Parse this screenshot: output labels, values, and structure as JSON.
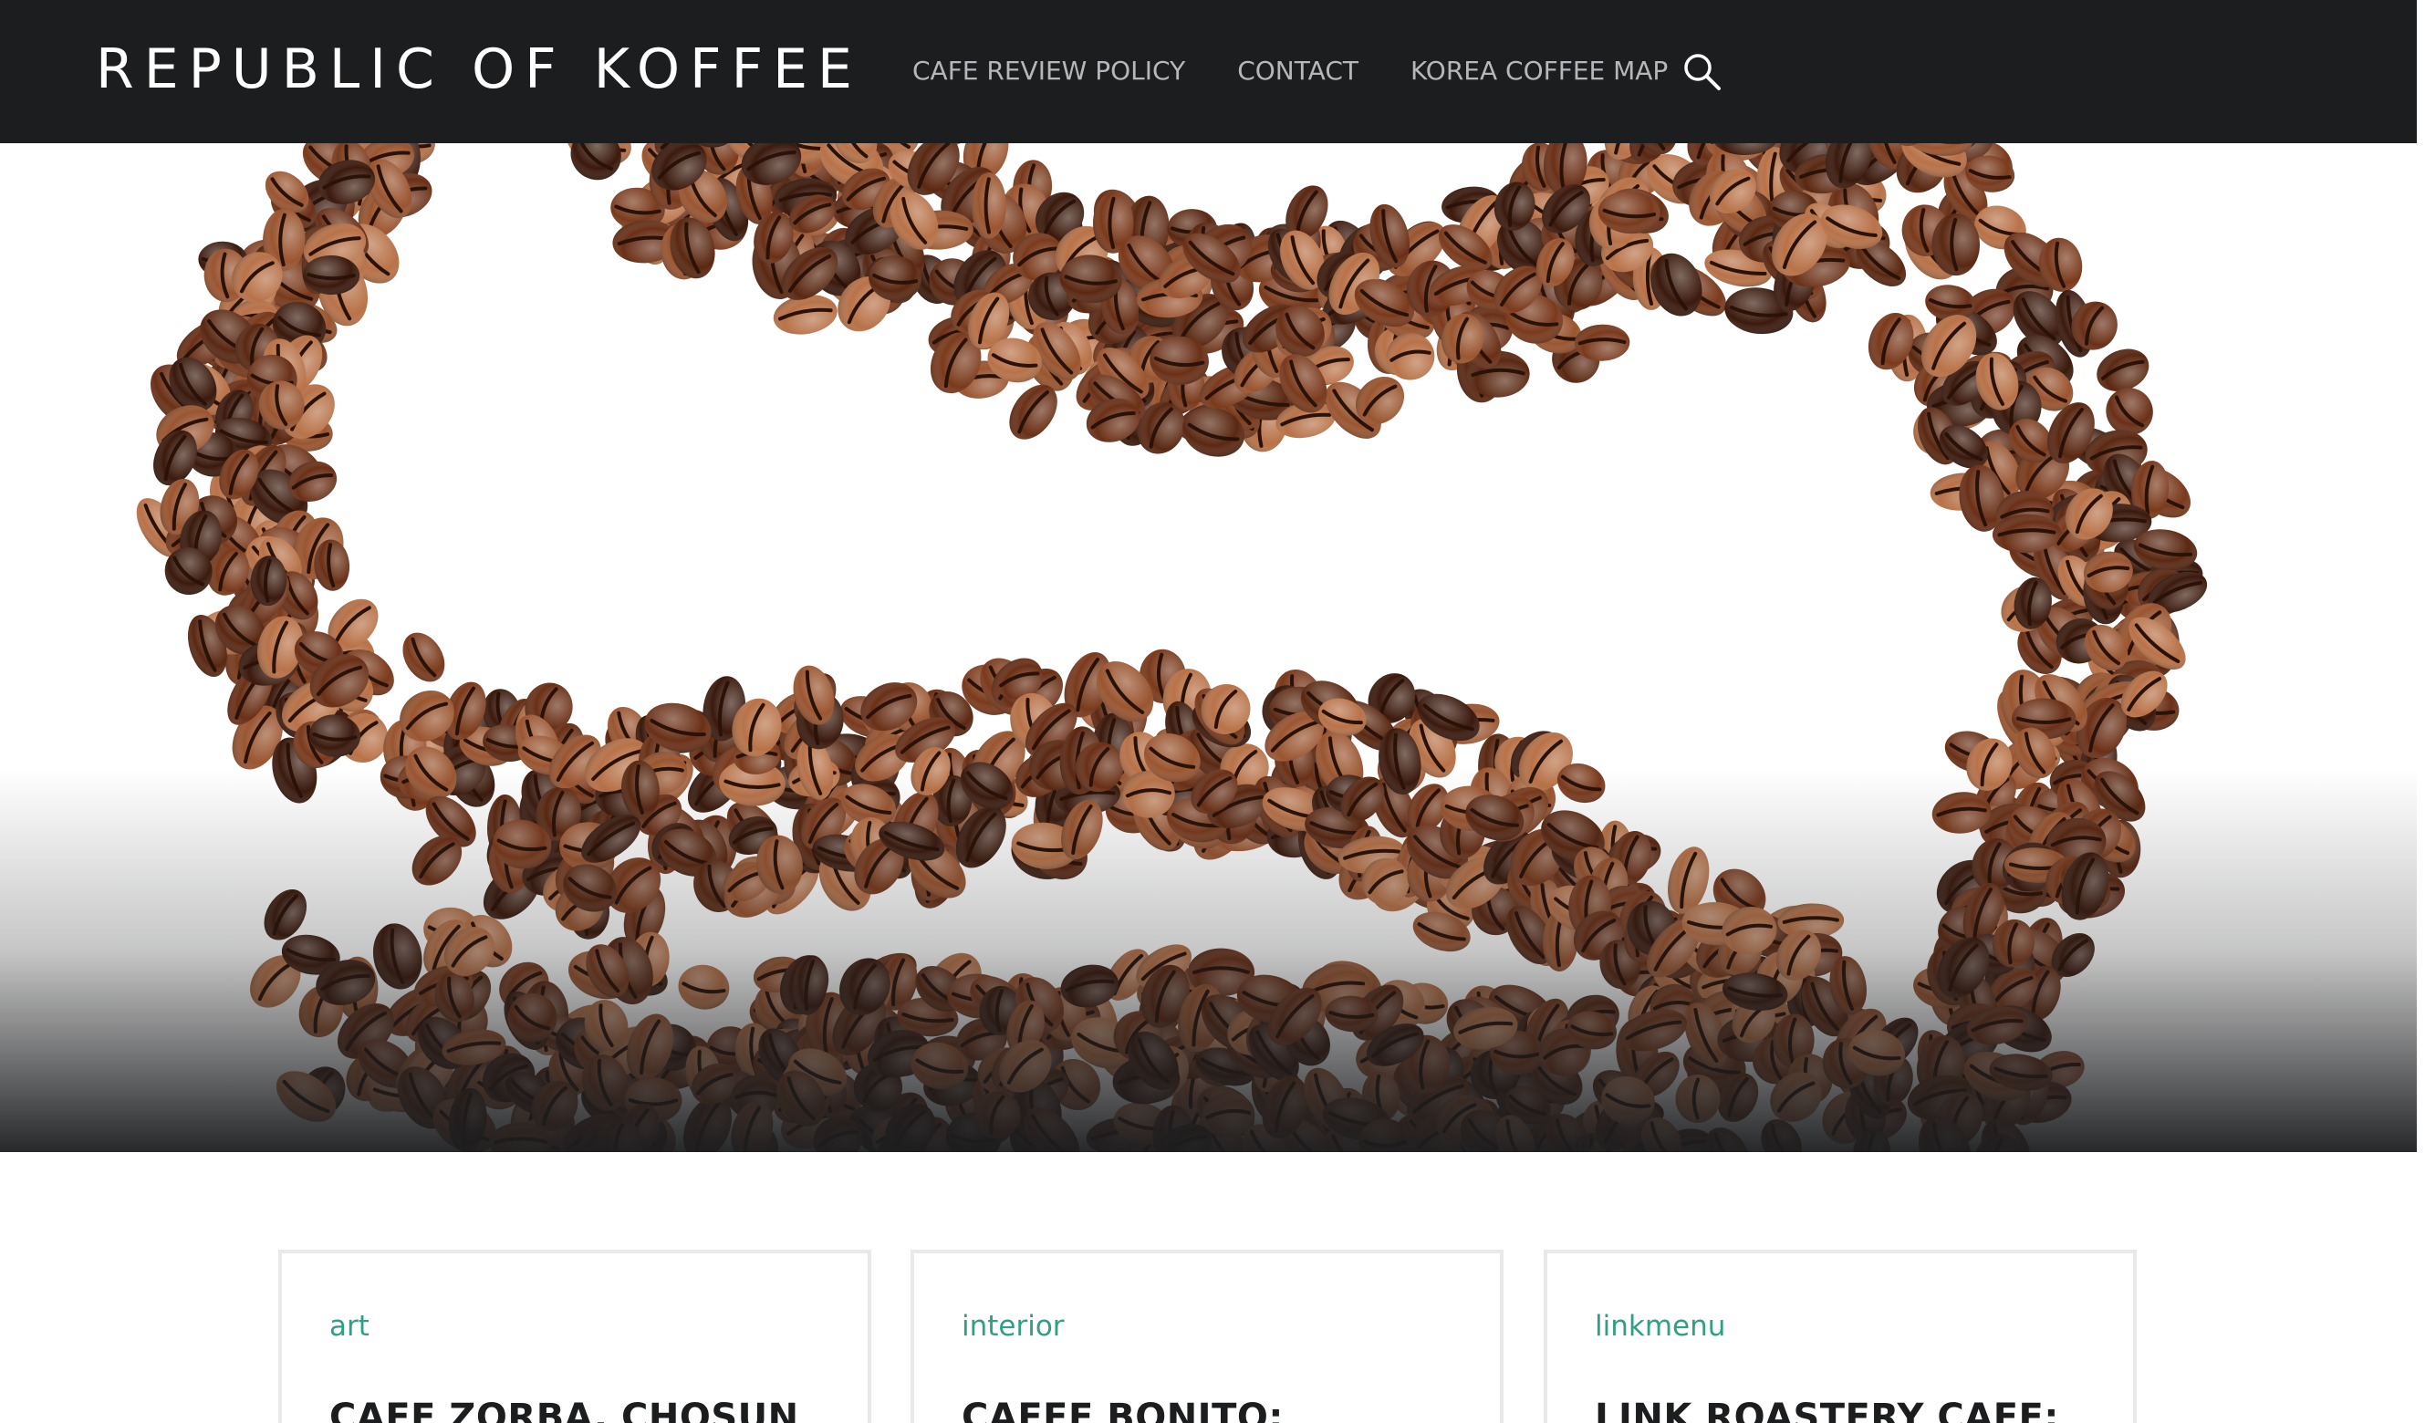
{
  "header": {
    "site_title": "REPUBLIC OF KOFFEE",
    "nav": [
      {
        "label": "CAFE REVIEW POLICY"
      },
      {
        "label": "CONTACT"
      },
      {
        "label": "KOREA COFFEE MAP"
      }
    ],
    "search_icon": "search-icon"
  },
  "hero": {
    "image": "coffee beans arranged in a wavy yin-yang pattern",
    "bean_colors": [
      "#3b1a0d",
      "#5a2812",
      "#7a3a1c",
      "#9a5530",
      "#b87248",
      "#6a3017"
    ],
    "gradient_color": "#1c1d1f"
  },
  "posts": [
    {
      "category": "art",
      "title": "CAFE ZORBA, CHOSUN"
    },
    {
      "category": "interior",
      "title": "CAFFE BONITO:"
    },
    {
      "category": "linkmenu",
      "title": "LINK ROASTERY CAFE:"
    }
  ],
  "colors": {
    "header_bg": "#1c1d1f",
    "nav_text": "#b5b7ba",
    "category_accent": "#2f9f85",
    "card_border": "#e9e9e9"
  }
}
